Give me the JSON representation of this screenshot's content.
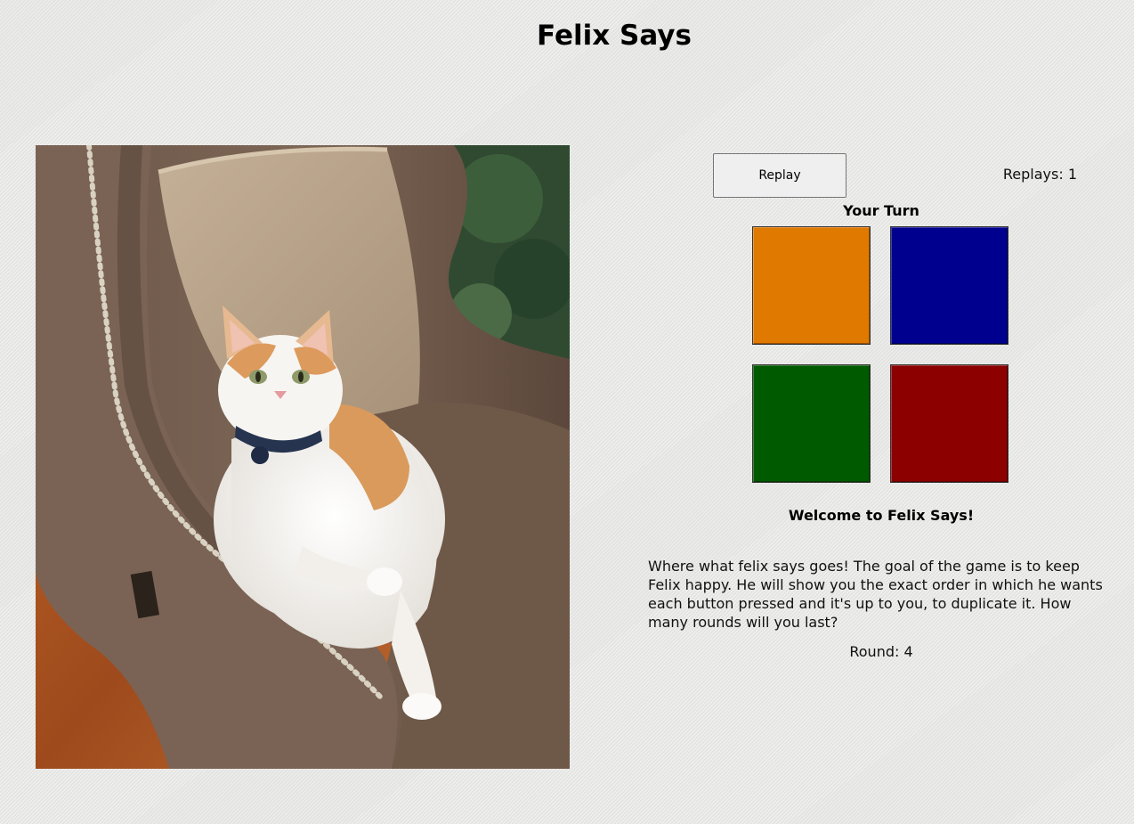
{
  "title": "Felix Says",
  "photo": {
    "subject": "orange-and-white cat on a brown armchair"
  },
  "controls": {
    "replay_label": "Replay",
    "replays_text": "Replays: 1"
  },
  "status": {
    "turn_text": "Your Turn"
  },
  "pads": [
    {
      "name": "orange",
      "color": "#e07900"
    },
    {
      "name": "blue",
      "color": "#00008e"
    },
    {
      "name": "green",
      "color": "#005a00"
    },
    {
      "name": "red",
      "color": "#8c0000"
    }
  ],
  "info": {
    "welcome": "Welcome to Felix Says!",
    "description": "Where what felix says goes! The goal of the game is to keep Felix happy. He will show you the exact order in which he wants each button pressed and it's up to you, to duplicate it. How many rounds will you last?",
    "round_text": "Round: 4"
  }
}
